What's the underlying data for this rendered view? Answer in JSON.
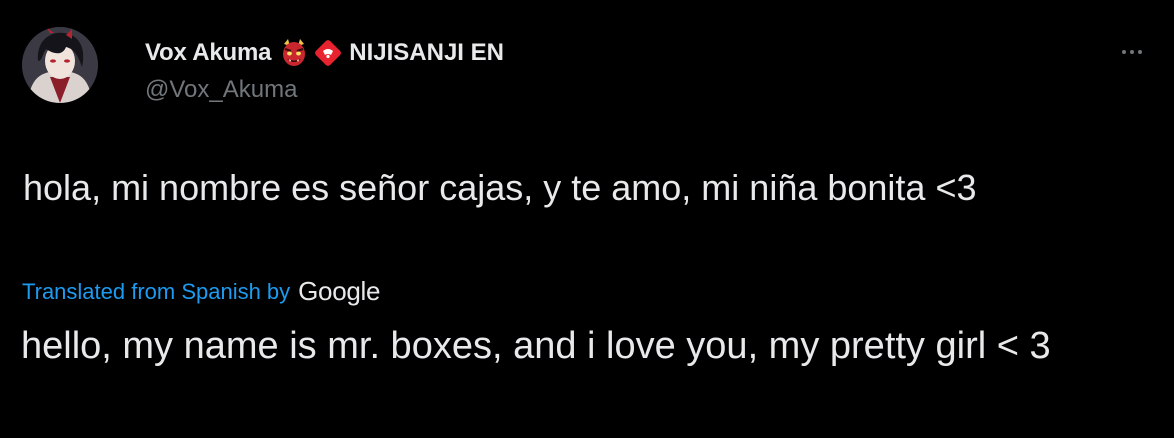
{
  "author": {
    "display_name": "Vox Akuma",
    "emoji": "oni-mask",
    "affiliation_badge": "red-diamond-badge",
    "affiliation": "NIJISANJI EN",
    "handle": "@Vox_Akuma"
  },
  "tweet": {
    "text": "hola, mi nombre es señor cajas, y te amo, mi niña bonita <3"
  },
  "translation": {
    "link_label": "Translated from Spanish",
    "by_label": "by",
    "provider": "Google",
    "text": "hello, my name is mr. boxes, and i love you, my pretty girl < 3"
  },
  "menu": {
    "icon": "more-horizontal-icon"
  },
  "colors": {
    "background": "#000000",
    "primary_text": "#e7e9ea",
    "secondary_text": "#71767b",
    "link": "#1d9bf0"
  }
}
